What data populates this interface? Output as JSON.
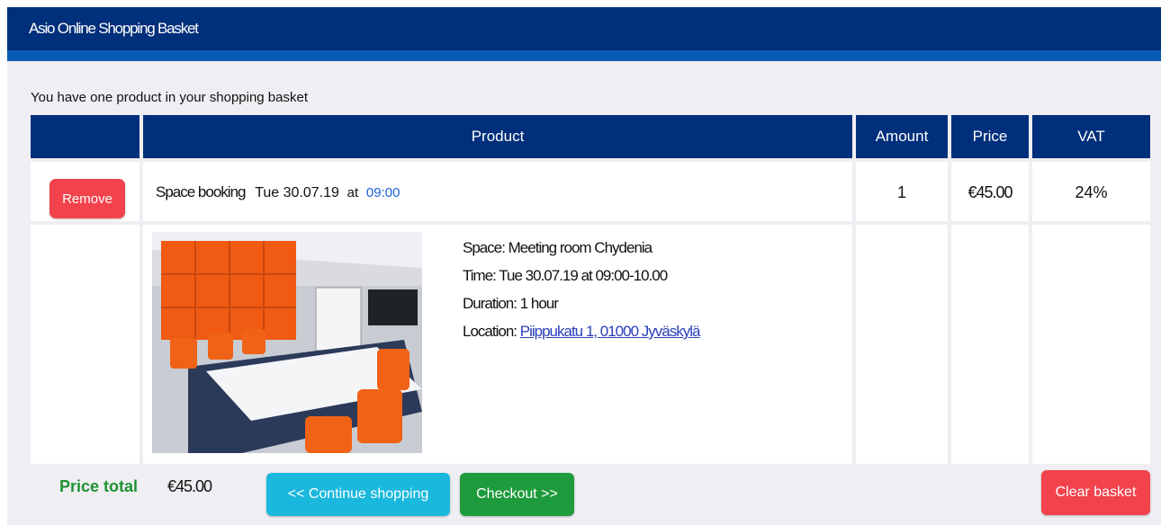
{
  "header": {
    "title": "Asio Online Shopping Basket"
  },
  "basket_info": "You have one product in your shopping basket",
  "table": {
    "columns": [
      "",
      "Product",
      "Amount",
      "Price",
      "VAT"
    ],
    "row": {
      "remove_label": "Remove",
      "product_name": "Space booking",
      "date": "Tue 30.07.19",
      "at": "at",
      "time": "09:00",
      "amount": "1",
      "price": "€45.00",
      "vat": "24%"
    },
    "details": {
      "space": "Space: Meeting room Chydenia",
      "time": "Time: Tue 30.07.19 at 09:00-10.00",
      "duration": "Duration: 1 hour",
      "location_label": "Location: ",
      "location_link": "Piippukatu 1, 01000 Jyväskylä"
    }
  },
  "footer": {
    "total_label": "Price total",
    "total_value": "€45.00",
    "continue_label": "<< Continue shopping",
    "checkout_label": "Checkout >>",
    "clear_label": "Clear basket"
  },
  "colors": {
    "header": "#002f7b",
    "stripe": "#0b5cb4",
    "danger": "#f2434d",
    "info": "#1ab8dc",
    "success": "#1e9b3c",
    "total_label": "#1e9333",
    "link": "#2a3fb8"
  }
}
